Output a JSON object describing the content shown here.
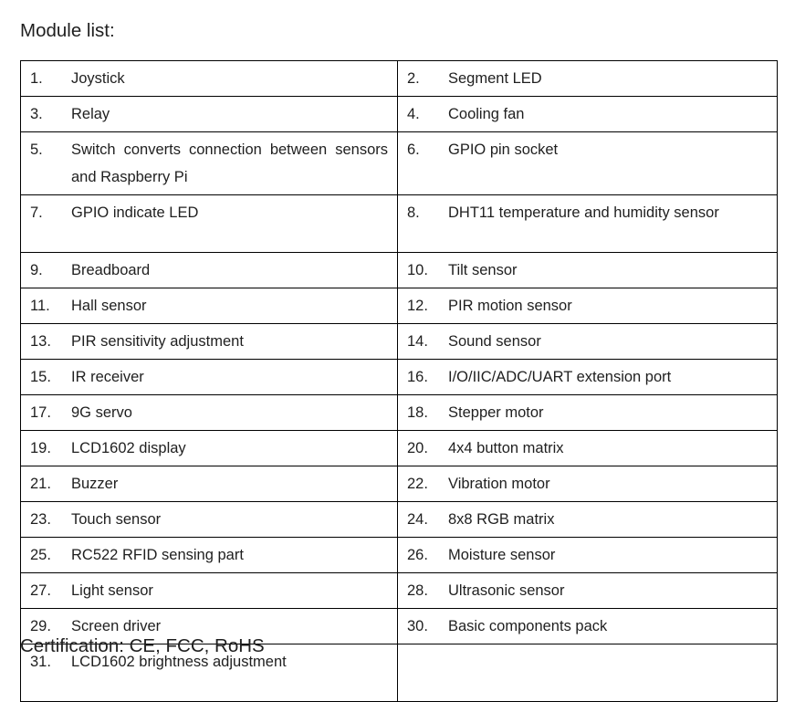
{
  "document": {
    "heading": "Module list:",
    "certification": "Certification: CE, FCC, RoHS"
  },
  "table": {
    "columns": 2,
    "rows": [
      {
        "left": {
          "num": "1.",
          "text": "Joystick",
          "justify": false,
          "tall": false
        },
        "right": {
          "num": "2.",
          "text": "Segment LED",
          "justify": false,
          "tall": false
        }
      },
      {
        "left": {
          "num": "3.",
          "text": "Relay",
          "justify": false,
          "tall": false
        },
        "right": {
          "num": "4.",
          "text": "Cooling fan",
          "justify": false,
          "tall": false
        }
      },
      {
        "left": {
          "num": "5.",
          "text": "Switch converts connection between sensors and Raspberry Pi",
          "justify": true,
          "tall": true
        },
        "right": {
          "num": "6.",
          "text": "GPIO pin socket",
          "justify": false,
          "tall": true
        }
      },
      {
        "left": {
          "num": "7.",
          "text": "GPIO indicate LED",
          "justify": false,
          "tall": true
        },
        "right": {
          "num": "8.",
          "text": "DHT11 temperature and humidity sensor",
          "justify": true,
          "tall": true
        }
      },
      {
        "left": {
          "num": "9.",
          "text": "Breadboard",
          "justify": false,
          "tall": false
        },
        "right": {
          "num": "10.",
          "text": "Tilt sensor",
          "justify": false,
          "tall": false
        }
      },
      {
        "left": {
          "num": "11.",
          "text": "Hall sensor",
          "justify": false,
          "tall": false
        },
        "right": {
          "num": "12.",
          "text": "PIR motion sensor",
          "justify": false,
          "tall": false
        }
      },
      {
        "left": {
          "num": "13.",
          "text": "PIR sensitivity adjustment",
          "justify": false,
          "tall": false
        },
        "right": {
          "num": "14.",
          "text": "Sound sensor",
          "justify": false,
          "tall": false
        }
      },
      {
        "left": {
          "num": "15.",
          "text": "IR receiver",
          "justify": false,
          "tall": false
        },
        "right": {
          "num": "16.",
          "text": "I/O/IIC/ADC/UART extension port",
          "justify": false,
          "tall": false
        }
      },
      {
        "left": {
          "num": "17.",
          "text": "9G servo",
          "justify": false,
          "tall": false
        },
        "right": {
          "num": "18.",
          "text": "Stepper motor",
          "justify": false,
          "tall": false
        }
      },
      {
        "left": {
          "num": "19.",
          "text": "LCD1602 display",
          "justify": false,
          "tall": false
        },
        "right": {
          "num": "20.",
          "text": "4x4 button matrix",
          "justify": false,
          "tall": false
        }
      },
      {
        "left": {
          "num": "21.",
          "text": "Buzzer",
          "justify": false,
          "tall": false
        },
        "right": {
          "num": "22.",
          "text": "Vibration motor",
          "justify": false,
          "tall": false
        }
      },
      {
        "left": {
          "num": "23.",
          "text": "Touch sensor",
          "justify": false,
          "tall": false
        },
        "right": {
          "num": "24.",
          "text": "8x8 RGB matrix",
          "justify": false,
          "tall": false
        }
      },
      {
        "left": {
          "num": "25.",
          "text": "RC522 RFID sensing part",
          "justify": false,
          "tall": false
        },
        "right": {
          "num": "26.",
          "text": "Moisture sensor",
          "justify": false,
          "tall": false
        }
      },
      {
        "left": {
          "num": "27.",
          "text": "Light sensor",
          "justify": false,
          "tall": false
        },
        "right": {
          "num": "28.",
          "text": "Ultrasonic sensor",
          "justify": false,
          "tall": false
        }
      },
      {
        "left": {
          "num": "29.",
          "text": "Screen driver",
          "justify": false,
          "tall": false
        },
        "right": {
          "num": "30.",
          "text": "Basic components pack",
          "justify": false,
          "tall": false
        }
      },
      {
        "left": {
          "num": "31.",
          "text": "LCD1602 brightness adjustment",
          "justify": false,
          "tall": true
        },
        "right": {
          "num": "",
          "text": "",
          "justify": false,
          "tall": true
        }
      }
    ]
  },
  "colors": {
    "page_background": "#ffffff",
    "text": "#1f1f1f",
    "table_border": "#000000"
  }
}
